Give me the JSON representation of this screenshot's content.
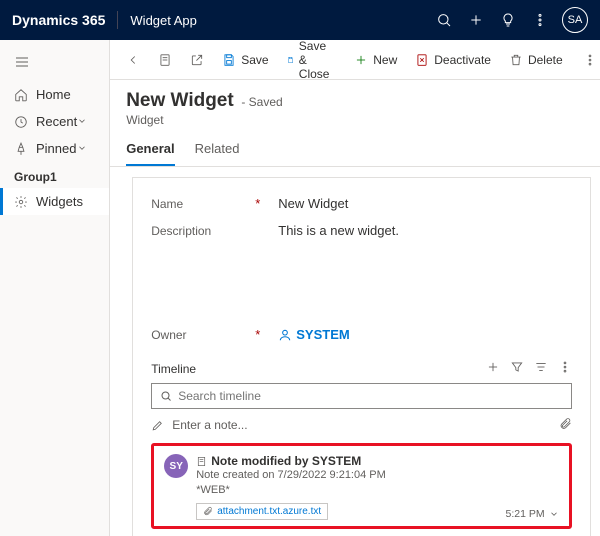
{
  "topbar": {
    "brand": "Dynamics 365",
    "app": "Widget App",
    "avatar": "SA"
  },
  "sidebar": {
    "home": "Home",
    "recent": "Recent",
    "pinned": "Pinned",
    "group": "Group1",
    "widgets": "Widgets"
  },
  "commands": {
    "save": "Save",
    "save_close": "Save & Close",
    "new": "New",
    "deactivate": "Deactivate",
    "delete": "Delete"
  },
  "header": {
    "title": "New Widget",
    "saved": "- Saved",
    "entity": "Widget"
  },
  "tabs": {
    "general": "General",
    "related": "Related"
  },
  "form": {
    "name_label": "Name",
    "name_value": "New Widget",
    "desc_label": "Description",
    "desc_value": "This is a new widget.",
    "owner_label": "Owner",
    "owner_value": "SYSTEM"
  },
  "timeline": {
    "label": "Timeline",
    "search_placeholder": "Search timeline",
    "note_placeholder": "Enter a note...",
    "card": {
      "avatar": "SY",
      "title": "Note modified by SYSTEM",
      "created": "Note created on 7/29/2022 9:21:04 PM",
      "tag": "*WEB*",
      "attachment": "attachment.txt.azure.txt",
      "time": "5:21 PM"
    }
  }
}
